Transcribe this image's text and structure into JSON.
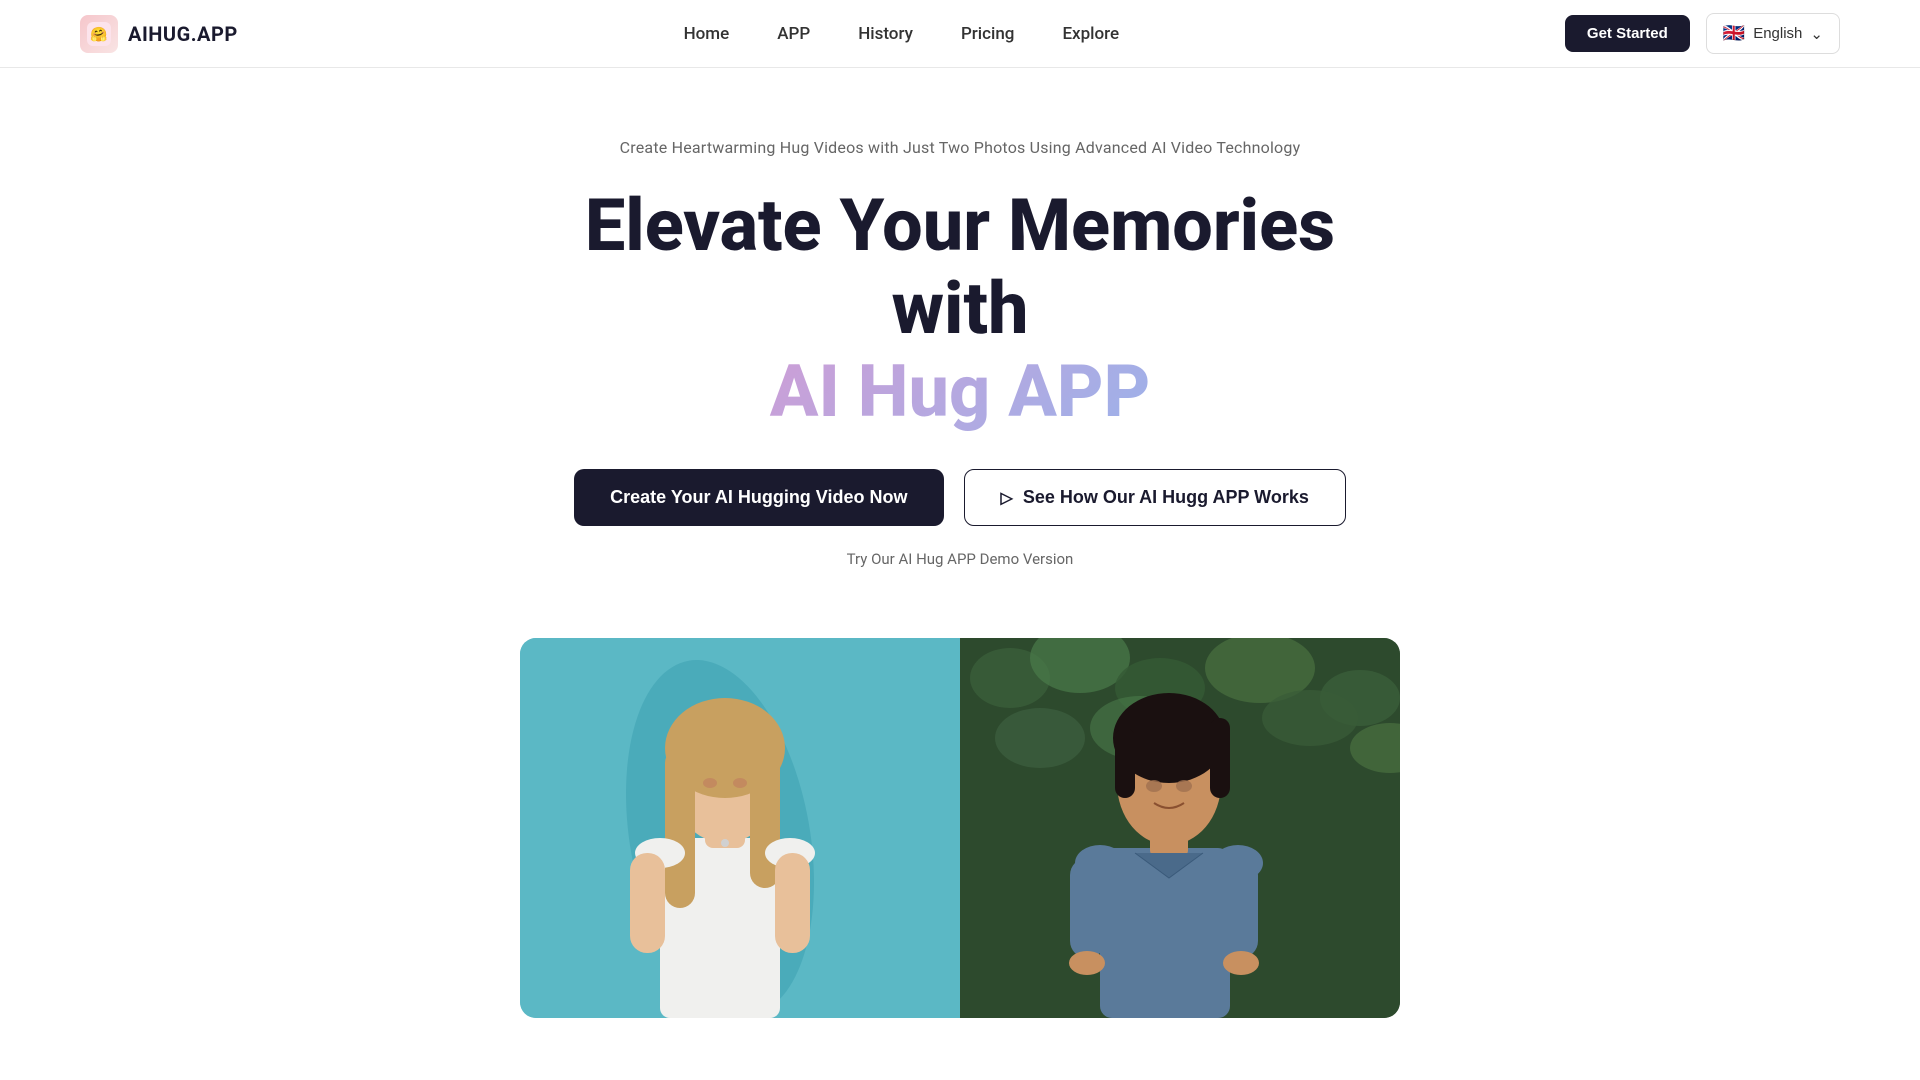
{
  "navbar": {
    "logo_icon": "🤗",
    "logo_text": "AIHUG.APP",
    "nav_items": [
      {
        "label": "Home",
        "id": "home"
      },
      {
        "label": "APP",
        "id": "app"
      },
      {
        "label": "History",
        "id": "history"
      },
      {
        "label": "Pricing",
        "id": "pricing"
      },
      {
        "label": "Explore",
        "id": "explore"
      }
    ],
    "get_started_label": "Get Started",
    "language_flag": "🇬🇧",
    "language_label": "English",
    "language_arrow": "⌄"
  },
  "hero": {
    "subtitle": "Create Heartwarming Hug Videos with Just Two Photos Using Advanced AI Video Technology",
    "title_line1": "Elevate Your Memories with",
    "title_line2": "AI Hug APP",
    "btn_create_label": "Create Your AI Hugging Video Now",
    "btn_how_label": "See How Our AI Hugg APP Works",
    "demo_link": "Try Our AI Hug APP Demo Version"
  }
}
